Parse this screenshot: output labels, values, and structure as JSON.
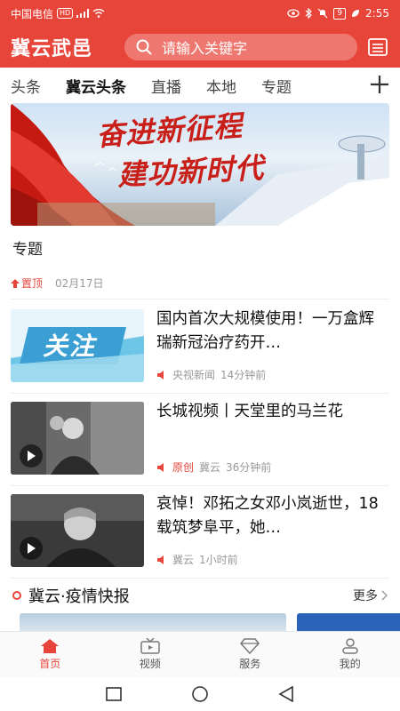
{
  "status_bar": {
    "carrier": "中国电信",
    "hd": "HD",
    "battery": "9",
    "time": "2:55"
  },
  "header": {
    "app_title": "冀云武邑",
    "search_placeholder": "请输入关键字"
  },
  "tabs": [
    {
      "label": "头条"
    },
    {
      "label": "冀云头条",
      "active": true
    },
    {
      "label": "直播"
    },
    {
      "label": "本地"
    },
    {
      "label": "专题"
    }
  ],
  "banner": {
    "line1": "奋进新征程",
    "line2": "建功新时代"
  },
  "section": {
    "label": "专题",
    "pin_label": "置顶",
    "pin_date": "02月17日"
  },
  "news": [
    {
      "title": "国内首次大规模使用！一万盒辉瑞新冠治疗药开…",
      "source": "央视新闻",
      "time": "14分钟前",
      "thumb_text": "关注"
    },
    {
      "title": "长城视频丨天堂里的马兰花",
      "tag": "原创",
      "source": "冀云",
      "time": "36分钟前"
    },
    {
      "title": "哀悼！邓拓之女邓小岚逝世，18载筑梦阜平，她…",
      "source": "冀云",
      "time": "1小时前"
    }
  ],
  "epidemic": {
    "title": "冀云·疫情快报",
    "more": "更多"
  },
  "bottom_nav": [
    {
      "label": "首页",
      "active": true
    },
    {
      "label": "视频"
    },
    {
      "label": "服务"
    },
    {
      "label": "我的"
    }
  ],
  "colors": {
    "brand": "#e8453a"
  }
}
